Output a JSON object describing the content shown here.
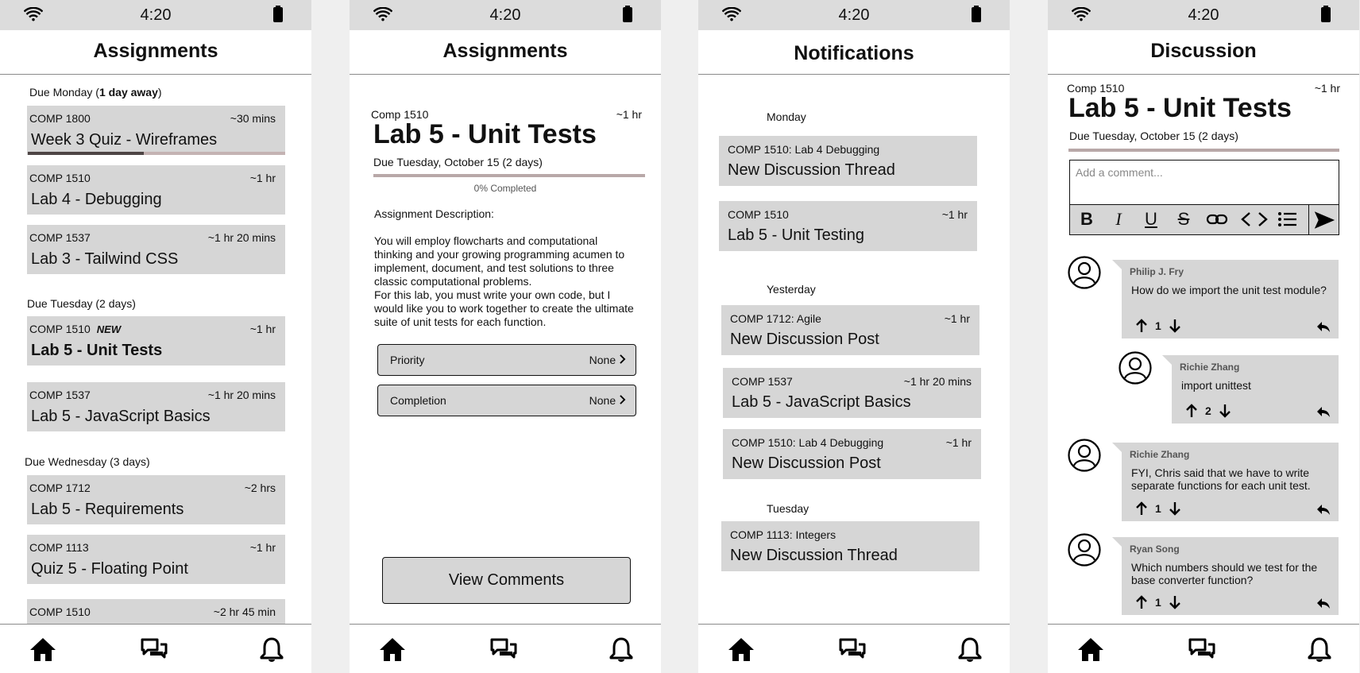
{
  "status": {
    "time": "4:20"
  },
  "screen1": {
    "title": "Assignments",
    "sec1_prefix": "Due Monday (",
    "sec1_bold": "1 day away",
    "sec1_suffix": ")",
    "sec2": "Due Tuesday (2 days)",
    "sec3": "Due Wednesday (3 days)",
    "cards": [
      {
        "code": "COMP 1800",
        "time": "~30 mins",
        "title": "Week 3 Quiz - Wireframes",
        "progress": 0.45
      },
      {
        "code": "COMP 1510",
        "time": "~1 hr",
        "title": "Lab 4 - Debugging"
      },
      {
        "code": "COMP 1537",
        "time": "~1 hr 20 mins",
        "title": "Lab 3 - Tailwind CSS"
      },
      {
        "code": "COMP 1510",
        "badge": "NEW",
        "time": "~1 hr",
        "title": "Lab 5 - Unit Tests"
      },
      {
        "code": "COMP 1537",
        "time": "~1 hr 20 mins",
        "title": "Lab 5 - JavaScript Basics"
      },
      {
        "code": "COMP 1712",
        "time": "~2 hrs",
        "title": "Lab 5 - Requirements"
      },
      {
        "code": "COMP 1113",
        "time": "~1 hr",
        "title": "Quiz 5 - Floating Point"
      },
      {
        "code": "COMP 1510",
        "time": "~2 hr 45 min",
        "title": ""
      }
    ]
  },
  "screen2": {
    "title": "Assignments",
    "code": "Comp 1510",
    "time": "~1 hr",
    "heading": "Lab 5 - Unit Tests",
    "due": "Due Tuesday, October 15 (2 days)",
    "completed_text": "0% Completed",
    "completed": 0,
    "desc_label": "Assignment Description:",
    "desc_p1": "You will employ flowcharts and computational thinking and your growing programming acumen to implement, document, and test solutions to three classic computational problems.",
    "desc_p2": "For this lab, you must write your own code, but I would like you to work together to create the ultimate suite of unit tests for each function.",
    "priority_label": "Priority",
    "priority_value": "None",
    "completion_label": "Completion",
    "completion_value": "None",
    "view_comments": "View Comments"
  },
  "screen3": {
    "title": "Notifications",
    "days": [
      "Monday",
      "Yesterday",
      "Tuesday"
    ],
    "items": [
      {
        "code": "COMP 1510: Lab 4 Debugging",
        "time": "",
        "title": "New Discussion Thread"
      },
      {
        "code": "COMP 1510",
        "time": "~1 hr",
        "title": "Lab 5 - Unit Testing"
      },
      {
        "code": "COMP 1712: Agile",
        "time": "~1 hr",
        "title": "New Discussion Post"
      },
      {
        "code": "COMP 1537",
        "time": "~1 hr 20 mins",
        "title": "Lab 5 - JavaScript Basics"
      },
      {
        "code": "COMP 1510: Lab 4 Debugging",
        "time": "~1 hr",
        "title": "New Discussion Post"
      },
      {
        "code": "COMP 1113: Integers",
        "time": "",
        "title": "New Discussion Thread"
      }
    ]
  },
  "screen4": {
    "title": "Discussion",
    "code": "Comp 1510",
    "time": "~1 hr",
    "heading": "Lab 5 - Unit Tests",
    "due": "Due Tuesday, October 15 (2 days)",
    "comment_placeholder": "Add a comment...",
    "comments": [
      {
        "author": "Philip J. Fry",
        "text": "How do we import the unit test module?",
        "votes": "1"
      },
      {
        "author": "Richie Zhang",
        "text": "import unittest",
        "votes": "2"
      },
      {
        "author": "Richie Zhang",
        "text": "FYI, Chris said that we have to write separate functions for each unit test.",
        "votes": "1"
      },
      {
        "author": "Ryan Song",
        "text": "Which numbers should we test for the base converter function?",
        "votes": "1"
      }
    ]
  }
}
